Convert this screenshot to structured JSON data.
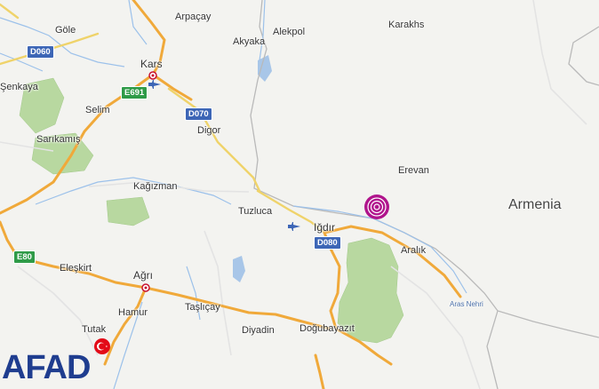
{
  "map": {
    "places": [
      {
        "id": "gole",
        "text": "Göle"
      },
      {
        "id": "senkaya",
        "text": "Şenkaya"
      },
      {
        "id": "kars",
        "text": "Kars"
      },
      {
        "id": "arpacay",
        "text": "Arpaçay"
      },
      {
        "id": "akyaka",
        "text": "Akyaka"
      },
      {
        "id": "alekpol",
        "text": "Alekpol"
      },
      {
        "id": "karakhs",
        "text": "Karakhs"
      },
      {
        "id": "selim",
        "text": "Selim"
      },
      {
        "id": "sarikamis",
        "text": "Sarıkamış"
      },
      {
        "id": "digor",
        "text": "Digor"
      },
      {
        "id": "kagizman",
        "text": "Kağızman"
      },
      {
        "id": "erevan",
        "text": "Erevan"
      },
      {
        "id": "armenia",
        "text": "Armenia"
      },
      {
        "id": "tuzluca",
        "text": "Tuzluca"
      },
      {
        "id": "igdir",
        "text": "Iğdır"
      },
      {
        "id": "aralik",
        "text": "Aralık"
      },
      {
        "id": "aras_nehri",
        "text": "Aras Nehri"
      },
      {
        "id": "eleskirt",
        "text": "Eleşkirt"
      },
      {
        "id": "agri",
        "text": "Ağrı"
      },
      {
        "id": "hamur",
        "text": "Hamur"
      },
      {
        "id": "taslicay",
        "text": "Taşlıçay"
      },
      {
        "id": "diyadin",
        "text": "Diyadin"
      },
      {
        "id": "dogubayazit",
        "text": "Doğubayazıt"
      },
      {
        "id": "tutak",
        "text": "Tutak"
      }
    ],
    "road_shields": [
      {
        "id": "d060",
        "text": "D060",
        "color": "#3d66b6"
      },
      {
        "id": "e691",
        "text": "E691",
        "color": "#2f9b48"
      },
      {
        "id": "d070",
        "text": "D070",
        "color": "#3d66b6"
      },
      {
        "id": "d080",
        "text": "D080",
        "color": "#3d66b6"
      },
      {
        "id": "e80",
        "text": "E80",
        "color": "#2f9b48"
      }
    ],
    "epicenter_color": "#b0148c",
    "road_color": "#f0a93a",
    "secondary_road_color": "#efd36a",
    "water_color": "#a8c6e8",
    "park_color": "#b8d8a0"
  },
  "watermark": {
    "text": "AFAD",
    "color": "#1f3d8f"
  },
  "icons": [
    "airport-icon",
    "city-marker-icon",
    "epicenter-icon",
    "turkish-flag-icon"
  ]
}
